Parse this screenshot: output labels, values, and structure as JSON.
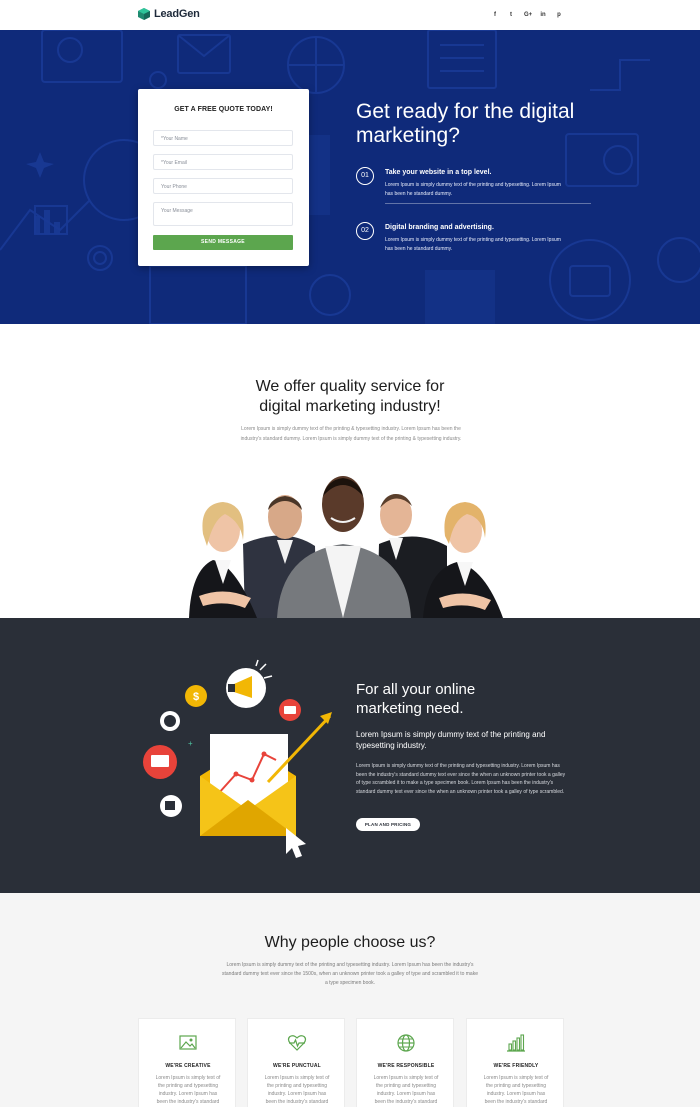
{
  "header": {
    "logo_text": "LeadGen",
    "social": [
      "f",
      "t",
      "G+",
      "in",
      "p"
    ]
  },
  "hero": {
    "form": {
      "title": "GET A FREE QUOTE TODAY!",
      "name_placeholder": "*Your Name",
      "email_placeholder": "*Your Email",
      "phone_placeholder": "Your Phone",
      "message_placeholder": "Your Message",
      "submit_label": "SEND MESSAGE"
    },
    "title": "Get ready for the digital marketing?",
    "features": [
      {
        "number": "01",
        "title": "Take your website in a top level.",
        "desc": "Lorem Ipsum is simply dummy text of the printing and typesetting. Lorem Ipsum has been he standard dummy."
      },
      {
        "number": "02",
        "title": "Digital branding and advertising.",
        "desc": "Lorem Ipsum is simply dummy text of the printing and typesetting. Lorem Ipsum has been he standard dummy."
      }
    ]
  },
  "service": {
    "title_line1": "We offer quality service for",
    "title_line2": "digital marketing industry!",
    "desc": "Lorem Ipsum is simply dummy text of the printing & typesetting industry. Lorem Ipsum has been the industry's standard dummy. Lorem Ipsum is simply dummy text of the printing & typesetting industry."
  },
  "marketing": {
    "title_line1": "For all your online",
    "title_line2": "marketing need.",
    "subtitle": "Lorem Ipsum is simply dummy text of the printing and typesetting industry.",
    "desc": "Lorem Ipsum is simply dummy text of the printing and typesetting industry. Lorem Ipsum has been the industry's standard dummy text ever since the when an unknown printer took a galley of type scrambled it to make a type specimen book. Lorem Ipsum has been the industry's standard dummy text ever since the when an unknown printer took a galley of type scrambled.",
    "button_label": "PLAN AND PRICING"
  },
  "why": {
    "title": "Why people choose us?",
    "desc": "Lorem Ipsum is simply dummy text of the printing and typesetting industry. Lorem Ipsum has been the industry's standard dummy text ever since the 1500s, when an unknown printer took a galley of type and scrambled it to make a type specimen book.",
    "cards": [
      {
        "icon": "picture-icon",
        "title": "WE'RE CREATIVE",
        "desc": "Lorem Ipsum is simply text of the printing and typesetting industry. Lorem Ipsum has been the industry's standard"
      },
      {
        "icon": "heartbeat-icon",
        "title": "WE'RE PUNCTUAL",
        "desc": "Lorem Ipsum is simply text of the printing and typesetting industry. Lorem Ipsum has been the industry's standard"
      },
      {
        "icon": "globe-icon",
        "title": "WE'RE RESPONSIBLE",
        "desc": "Lorem Ipsum is simply text of the printing and typesetting industry. Lorem Ipsum has been the industry's standard"
      },
      {
        "icon": "bar-chart-icon",
        "title": "WE'RE FRIENDLY",
        "desc": "Lorem Ipsum is simply text of the printing and typesetting industry. Lorem Ipsum has been the industry's standard"
      }
    ]
  },
  "colors": {
    "hero_blue": "#0f2a7a",
    "accent_green": "#5ca64e",
    "dark_section": "#2a2f38",
    "why_background": "#f5f5f5"
  }
}
